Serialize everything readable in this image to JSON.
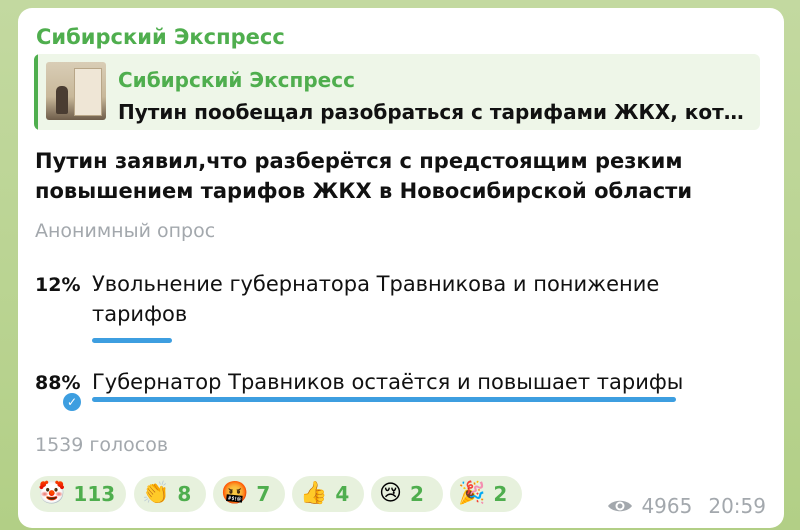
{
  "message": {
    "sender": "Сибирский Экспресс",
    "reply": {
      "title": "Сибирский Экспресс",
      "text": "Путин пообещал разобраться с тарифами ЖКХ, кото..."
    },
    "poll": {
      "question": "Путин заявил,что разберётся с предстоящим резким повышением тарифов ЖКХ в Новосибирской области",
      "type": "Анонимный опрос",
      "options": [
        {
          "percent": "12%",
          "text": "Увольнение губернатора Травникова и понижение тарифов",
          "fraction": 0.12,
          "chosen": false
        },
        {
          "percent": "88%",
          "text": "Губернатор Травников остаётся и повышает тарифы",
          "fraction": 0.88,
          "chosen": true
        }
      ],
      "votes": "1539 голосов"
    },
    "reactions": [
      {
        "icon": "clown-icon",
        "emoji": "🤡",
        "count": "113"
      },
      {
        "icon": "clap-icon",
        "emoji": "👏",
        "count": "8"
      },
      {
        "icon": "swearing-face-icon",
        "emoji": "🤬",
        "count": "7"
      },
      {
        "icon": "thumbs-up-icon",
        "emoji": "👍",
        "count": "4"
      },
      {
        "icon": "crying-face-icon",
        "emoji": "😢",
        "count": "2"
      },
      {
        "icon": "party-popper-icon",
        "emoji": "🎉",
        "count": "2"
      }
    ],
    "views": "4965",
    "time": "20:59"
  },
  "colors": {
    "accent_green": "#4fae4e",
    "bar_blue": "#3d9ee0",
    "muted_gray": "#a3a8ad"
  }
}
